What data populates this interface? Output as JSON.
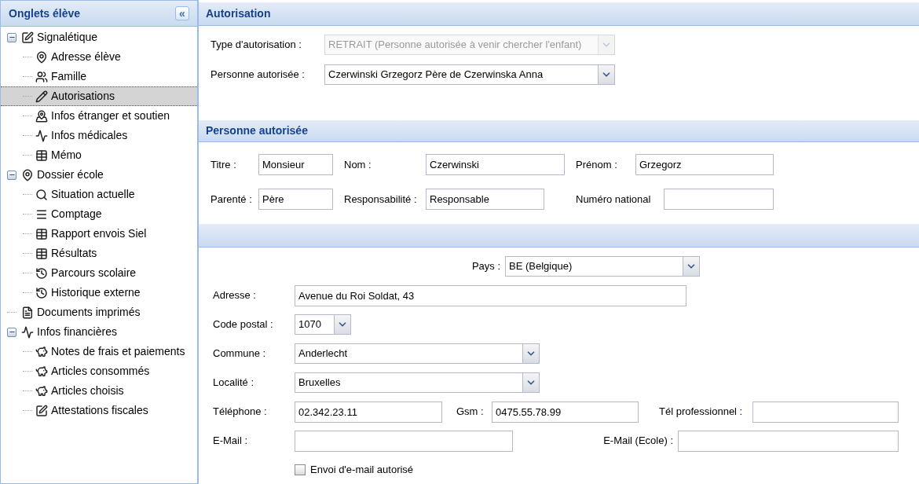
{
  "sidebar": {
    "title": "Onglets élève",
    "collapse_label": "«",
    "items": [
      {
        "label": "Signalétique",
        "expanded": true,
        "selected": false,
        "children": [
          {
            "label": "Adresse élève",
            "selected": false
          },
          {
            "label": "Famille",
            "selected": false
          },
          {
            "label": "Autorisations",
            "selected": true
          },
          {
            "label": "Infos étranger et soutien",
            "selected": false
          },
          {
            "label": "Infos médicales",
            "selected": false
          },
          {
            "label": "Mémo",
            "selected": false
          }
        ]
      },
      {
        "label": "Dossier école",
        "expanded": true,
        "selected": false,
        "children": [
          {
            "label": "Situation actuelle",
            "selected": false
          },
          {
            "label": "Comptage",
            "selected": false
          },
          {
            "label": "Rapport envois Siel",
            "selected": false
          },
          {
            "label": "Résultats",
            "selected": false
          },
          {
            "label": "Parcours scolaire",
            "selected": false
          },
          {
            "label": "Historique externe",
            "selected": false
          }
        ]
      },
      {
        "label": "Documents imprimés",
        "selected": false
      },
      {
        "label": "Infos financières",
        "expanded": true,
        "selected": false,
        "children": [
          {
            "label": "Notes de frais et paiements",
            "selected": false
          },
          {
            "label": "Articles consommés",
            "selected": false
          },
          {
            "label": "Articles choisis",
            "selected": false
          },
          {
            "label": "Attestations fiscales",
            "selected": false
          }
        ]
      }
    ]
  },
  "autorisation": {
    "title": "Autorisation",
    "fields": [
      {
        "label": "Type d'autorisation :",
        "value": "RETRAIT (Personne autorisée à venir chercher l'enfant)",
        "disabled": true
      },
      {
        "label": "Personne autorisée :",
        "value": "Czerwinski Grzegorz Père de Czerwinska Anna",
        "disabled": false
      }
    ]
  },
  "personne": {
    "title": "Personne autorisée",
    "rows": [
      [
        {
          "label": "Titre :",
          "value": "Monsieur"
        },
        {
          "label": "Nom :",
          "value": "Czerwinski"
        },
        {
          "label": "Prénom :",
          "value": "Grzegorz"
        }
      ],
      [
        {
          "label": "Parenté :",
          "value": "Père"
        },
        {
          "label": "Responsabilité :",
          "value": "Responsable"
        },
        {
          "label": "Numéro national"
        }
      ]
    ]
  },
  "adresse": {
    "rows": [
      [
        {
          "kind": "combo",
          "label": "Pays :",
          "value": "BE (Belgique)"
        }
      ],
      [
        {
          "kind": "text",
          "label": "Adresse :",
          "value": "Avenue du Roi Soldat, 43"
        }
      ],
      [
        {
          "kind": "combo",
          "label": "Code postal :",
          "value": "1070"
        }
      ],
      [
        {
          "kind": "combo",
          "label": "Commune :",
          "value": "Anderlecht"
        }
      ],
      [
        {
          "kind": "combo",
          "label": "Localité :",
          "value": "Bruxelles"
        }
      ],
      [
        {
          "kind": "text",
          "label": "Téléphone :",
          "value": "02.342.23.11"
        },
        {
          "kind": "text",
          "label": "Gsm :",
          "value": "0475.55.78.99"
        },
        {
          "kind": "text",
          "label": "Tél professionnel :"
        }
      ],
      [
        {
          "kind": "text",
          "label": "E-Mail :"
        },
        {
          "kind": "text",
          "label": "E-Mail (Ecole) :"
        }
      ],
      [
        {
          "kind": "checkbox",
          "label": "Envoi d'e-mail autorisé",
          "checked": false
        }
      ]
    ]
  }
}
